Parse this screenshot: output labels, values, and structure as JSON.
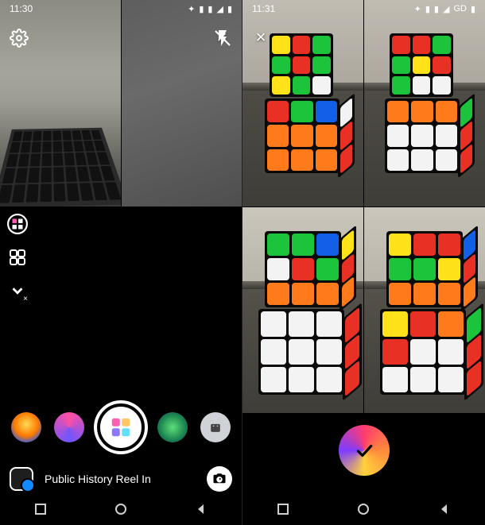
{
  "left": {
    "status": {
      "time": "11:30",
      "icons": [
        "bt",
        "sig",
        "sig",
        "wifi",
        "batt"
      ]
    },
    "close_tr": "×",
    "close_tl_right_quad": "×",
    "tools": {
      "layout_icon": "layout-icon",
      "grid_icon": "grid-icon",
      "chevron": "chevron-down-icon"
    },
    "effects": {
      "count": 5
    },
    "modes_text": "Public   History   Reel   In"
  },
  "right": {
    "status": {
      "time": "11:31",
      "gd": "GD",
      "icons": [
        "bt",
        "sig",
        "sig",
        "wifi",
        "batt"
      ]
    },
    "close_tl": "×",
    "confirm": "✓"
  }
}
